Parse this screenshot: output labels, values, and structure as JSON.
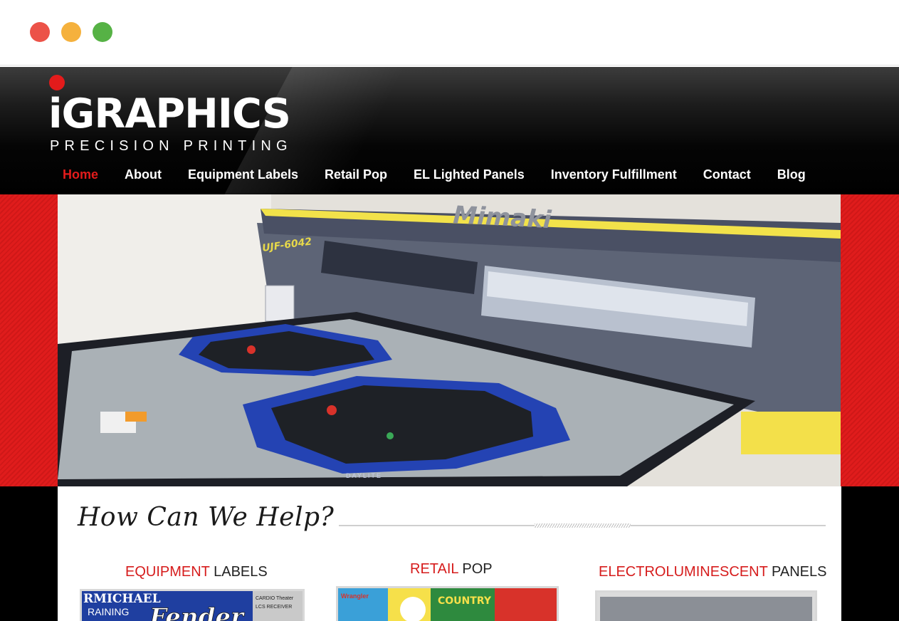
{
  "window": {
    "controls": [
      "close",
      "minimize",
      "maximize"
    ]
  },
  "header": {
    "logo_word": "iGRAPHICS",
    "logo_tagline": "PRECISION PRINTING",
    "nav": [
      {
        "label": "Home",
        "active": true
      },
      {
        "label": "About",
        "active": false
      },
      {
        "label": "Equipment Labels",
        "active": false
      },
      {
        "label": "Retail Pop",
        "active": false
      },
      {
        "label": "EL Lighted Panels",
        "active": false
      },
      {
        "label": "Inventory Fulfillment",
        "active": false
      },
      {
        "label": "Contact",
        "active": false
      },
      {
        "label": "Blog",
        "active": false
      }
    ]
  },
  "hero": {
    "printer_brand": "Mimaki",
    "printer_model": "UJF-6042",
    "panel_text": "DAYLITE"
  },
  "help": {
    "title": "How Can We Help?",
    "categories": [
      {
        "accent": "EQUIPMENT",
        "rest": " LABELS"
      },
      {
        "accent": "RETAIL",
        "rest": " POP"
      },
      {
        "accent": "ELECTROLUMINESCENT",
        "rest": " PANELS"
      }
    ],
    "thumb_text": {
      "equipment_1": "RMICHAEL",
      "equipment_2": "RAINING",
      "equipment_3": "Fender",
      "equipment_4": "CARDIO Theater",
      "equipment_5": "LCS RECEIVER",
      "retail_1": "Wrangler",
      "retail_2": "COUNTRY"
    }
  },
  "colors": {
    "accent_red": "#e31b1b",
    "header_black": "#000000",
    "band_red": "#e01c1c"
  }
}
